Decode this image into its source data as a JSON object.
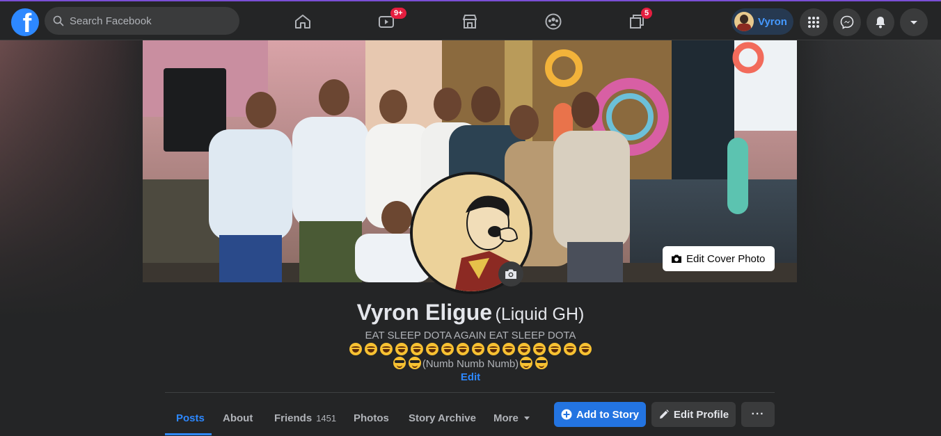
{
  "topbar": {
    "logo_letter": "f",
    "search_placeholder": "Search Facebook",
    "watch_badge": "9+",
    "groups_badge": "5",
    "profile_name": "Vyron"
  },
  "cover": {
    "edit_cover_label": "Edit Cover Photo"
  },
  "profile": {
    "name": "Vyron Eligue",
    "alt_name": "(Liquid GH)",
    "bio_line1": "EAT SLEEP DOTA AGAIN EAT SLEEP DOTA",
    "bio_line3_text": "(Numb Numb Numb)",
    "edit_label": "Edit"
  },
  "tabs": [
    {
      "label": "Posts",
      "active": true
    },
    {
      "label": "About"
    },
    {
      "label": "Friends",
      "count": "1451"
    },
    {
      "label": "Photos"
    },
    {
      "label": "Story Archive"
    },
    {
      "label": "More"
    }
  ],
  "actions": {
    "add_story": "Add to Story",
    "edit_profile": "Edit Profile",
    "more": "···"
  },
  "colors": {
    "accent": "#2d88ff",
    "badge": "#e41e3f",
    "background": "#18191a"
  }
}
